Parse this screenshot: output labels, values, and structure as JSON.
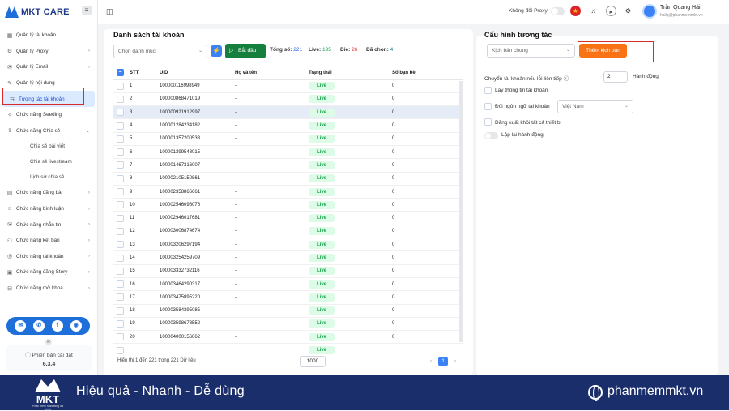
{
  "app": {
    "name": "MKT CARE"
  },
  "sidebar": {
    "items": [
      {
        "icon": "▦",
        "label": "Quản lý tài khoản",
        "chev": ""
      },
      {
        "icon": "⚙",
        "label": "Quản lý Proxy",
        "chev": "›"
      },
      {
        "icon": "✉",
        "label": "Quản lý Email",
        "chev": "›"
      },
      {
        "icon": "✎",
        "label": "Quản lý nội dung",
        "chev": ""
      },
      {
        "icon": "⇆",
        "label": "Tương tác tài khoản",
        "chev": ""
      },
      {
        "icon": "✧",
        "label": "Chức năng Seeding",
        "chev": ""
      },
      {
        "icon": "⇪",
        "label": "Chức năng Chia sẻ",
        "chev": "⌄"
      },
      {
        "icon": "",
        "label": "Chia sẻ bài viết",
        "chev": ""
      },
      {
        "icon": "",
        "label": "Chia sẻ livestream",
        "chev": ""
      },
      {
        "icon": "",
        "label": "Lịch sử chia sẻ",
        "chev": ""
      },
      {
        "icon": "▤",
        "label": "Chức năng đăng bài",
        "chev": "›"
      },
      {
        "icon": "☺",
        "label": "Chức năng bình luận",
        "chev": "›"
      },
      {
        "icon": "✉",
        "label": "Chức năng nhắn tin",
        "chev": "›"
      },
      {
        "icon": "⚇",
        "label": "Chức năng kết bạn",
        "chev": "›"
      },
      {
        "icon": "◎",
        "label": "Chức năng tài khoản",
        "chev": "›"
      },
      {
        "icon": "▣",
        "label": "Chức năng đăng Story",
        "chev": "›"
      },
      {
        "icon": "⊟",
        "label": "Chức năng mở khoá",
        "chev": "›"
      }
    ],
    "social": [
      "✉",
      "✆",
      "f",
      "◉"
    ],
    "version_badge": "R",
    "version_label": "Phiên bản cài đặt",
    "version": "6.3.4"
  },
  "topbar": {
    "proxy_label": "Không đổi Proxy",
    "user_name": "Trần Quang Hải",
    "user_email": "hailq@phanmemmkt.vn",
    "menu_icon": "≡",
    "layout_icon": "◫"
  },
  "accounts": {
    "title": "Danh sách tài khoản",
    "category_placeholder": "Chọn danh mục",
    "start_label": "Bắt đầu",
    "total_label": "Tổng số:",
    "total": "221",
    "live_label": "Live:",
    "live": "195",
    "die_label": "Die:",
    "die": "26",
    "selected_label": "Đã chọn:",
    "selected": "4",
    "columns": [
      "STT",
      "UID",
      "Họ và tên",
      "Trạng thái",
      "Số bạn bè"
    ],
    "rows": [
      [
        "1",
        "100000116998949",
        "-",
        "Live",
        "0"
      ],
      [
        "2",
        "100000868471019",
        "-",
        "Live",
        "0"
      ],
      [
        "3",
        "100000921912997",
        "-",
        "Live",
        "0"
      ],
      [
        "4",
        "100001284234182",
        "-",
        "Live",
        "0"
      ],
      [
        "5",
        "100001357200533",
        "-",
        "Live",
        "0"
      ],
      [
        "6",
        "100001399543015",
        "-",
        "Live",
        "0"
      ],
      [
        "7",
        "100001467316007",
        "-",
        "Live",
        "0"
      ],
      [
        "8",
        "100002105150861",
        "-",
        "Live",
        "0"
      ],
      [
        "9",
        "100002358866661",
        "-",
        "Live",
        "0"
      ],
      [
        "10",
        "100002546096076",
        "-",
        "Live",
        "0"
      ],
      [
        "11",
        "100002946017681",
        "-",
        "Live",
        "0"
      ],
      [
        "12",
        "100003006874674",
        "-",
        "Live",
        "0"
      ],
      [
        "13",
        "100003206297194",
        "-",
        "Live",
        "0"
      ],
      [
        "14",
        "100003254259709",
        "-",
        "Live",
        "0"
      ],
      [
        "15",
        "100003332732116",
        "-",
        "Live",
        "0"
      ],
      [
        "16",
        "100003464290317",
        "-",
        "Live",
        "0"
      ],
      [
        "17",
        "100003475895220",
        "-",
        "Live",
        "0"
      ],
      [
        "18",
        "100003584395085",
        "-",
        "Live",
        "0"
      ],
      [
        "19",
        "100003598673552",
        "-",
        "Live",
        "0"
      ],
      [
        "20",
        "100004000156062",
        "-",
        "Live",
        "0"
      ],
      [
        "",
        "",
        "",
        "Live",
        ""
      ]
    ],
    "footer": "Hiển thị 1 đến 221 trong 221 Dữ liệu",
    "page_size": "1000",
    "page": "1"
  },
  "config": {
    "title": "Cấu hình tương tác",
    "script_select": "Kịch bản chung",
    "add_script": "Thêm kịch bản",
    "switch_label": "Chuyển tài khoản nếu lỗi liên tiếp",
    "switch_value": "2",
    "switch_unit": "Hành động",
    "get_info": "Lấy thông tin tài khoản",
    "change_lang": "Đổi ngôn ngữ tài khoản",
    "language": "Việt Nam",
    "logout_all": "Đăng xuất khỏi tất cả thiết bị",
    "repeat": "Lặp lại hành động"
  },
  "banner": {
    "logo": "MKT",
    "logo_sub": "Phần mềm Marketing đa kênh",
    "slogan": "Hiệu quả - Nhanh - Dễ dùng",
    "website": "phanmemmkt.vn"
  }
}
